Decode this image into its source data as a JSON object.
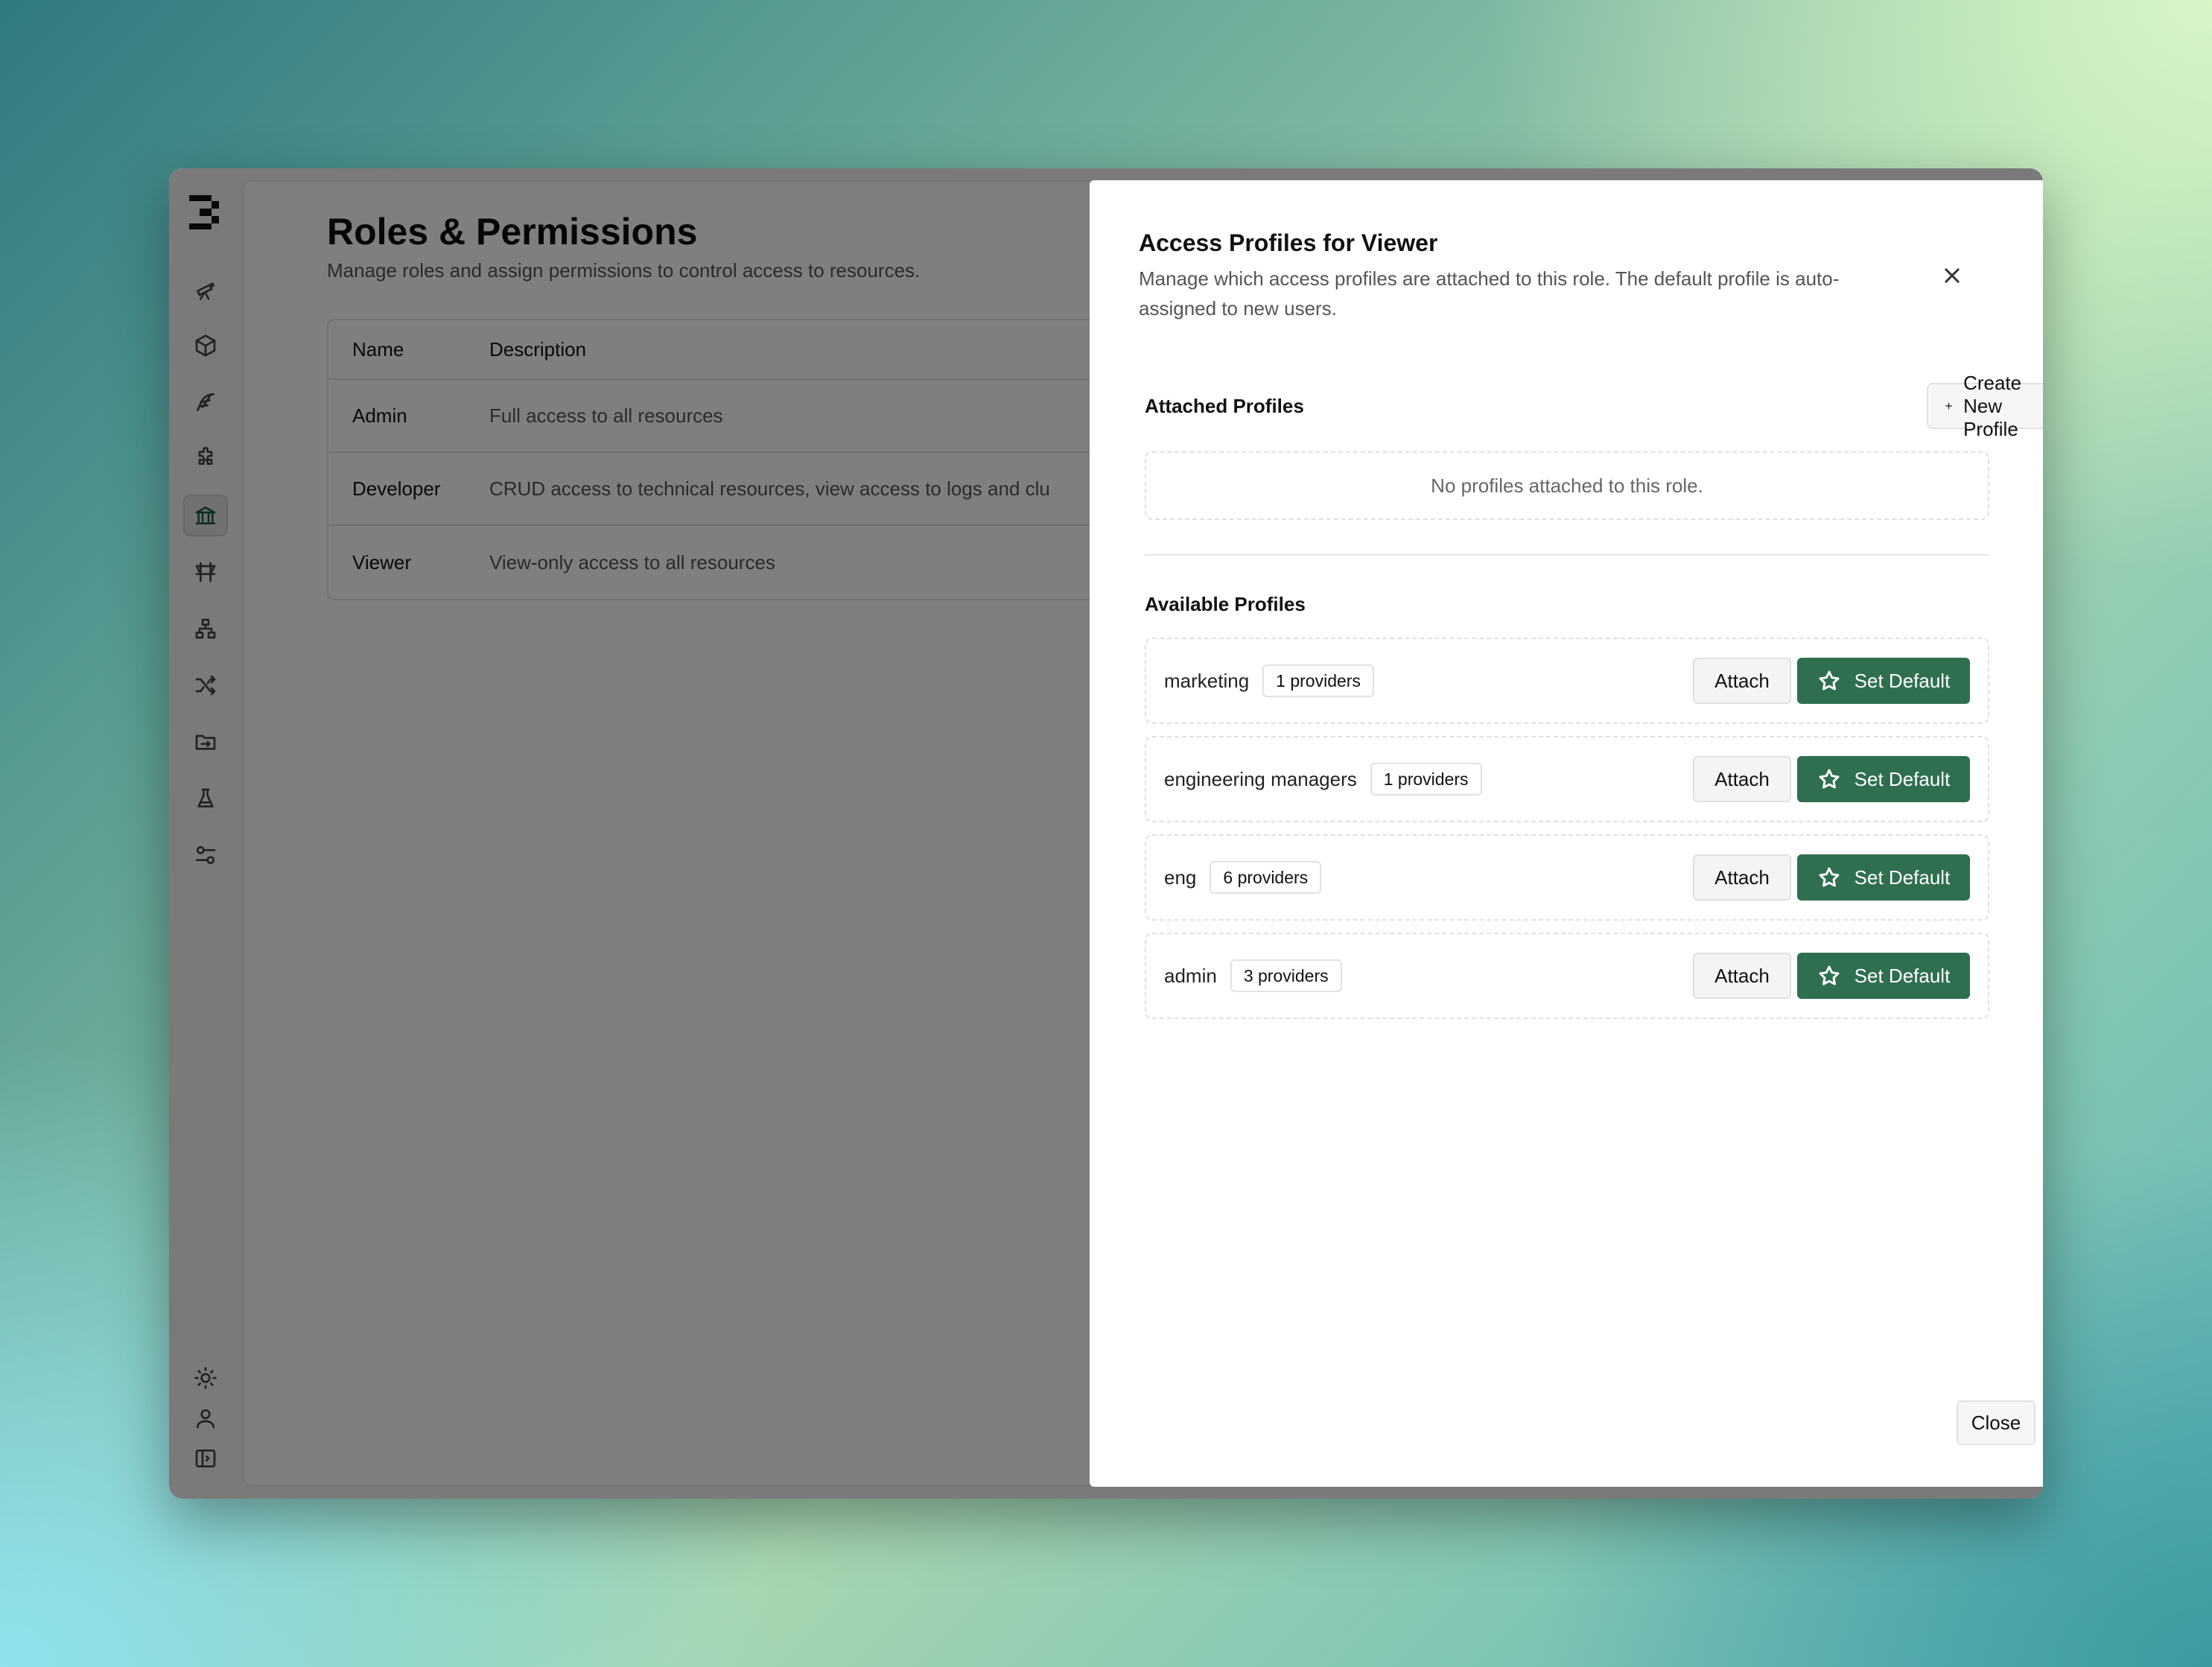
{
  "page": {
    "title": "Roles & Permissions",
    "subtitle": "Manage roles and assign permissions to control access to resources."
  },
  "table": {
    "headers": {
      "name": "Name",
      "description": "Description"
    },
    "rows": [
      {
        "name": "Admin",
        "description": "Full access to all resources"
      },
      {
        "name": "Developer",
        "description": "CRUD access to technical resources, view access to logs and clu"
      },
      {
        "name": "Viewer",
        "description": "View-only access to all resources"
      }
    ]
  },
  "sidebar": {
    "items": [
      {
        "icon": "telescope-icon"
      },
      {
        "icon": "box-icon"
      },
      {
        "icon": "feather-icon"
      },
      {
        "icon": "puzzle-icon"
      },
      {
        "icon": "bank-icon",
        "active": true
      },
      {
        "icon": "signpost-icon"
      },
      {
        "icon": "network-icon"
      },
      {
        "icon": "shuffle-icon"
      },
      {
        "icon": "folder-icon"
      },
      {
        "icon": "flask-icon"
      },
      {
        "icon": "settings-sliders-icon"
      }
    ],
    "bottom": [
      {
        "icon": "sun-icon"
      },
      {
        "icon": "user-icon"
      },
      {
        "icon": "sidebar-toggle-icon"
      }
    ]
  },
  "dialog": {
    "title": "Access Profiles for Viewer",
    "description": "Manage which access profiles are attached to this role. The default profile is auto-assigned to new users.",
    "attached_label": "Attached Profiles",
    "create_button": "Create New Profile",
    "empty_text": "No profiles attached to this role.",
    "available_label": "Available Profiles",
    "attach_label": "Attach",
    "set_default_label": "Set Default",
    "close_label": "Close",
    "profiles": [
      {
        "name": "marketing",
        "providers": "1 providers"
      },
      {
        "name": "engineering managers",
        "providers": "1 providers"
      },
      {
        "name": "eng",
        "providers": "6 providers"
      },
      {
        "name": "admin",
        "providers": "3 providers"
      }
    ]
  },
  "colors": {
    "accent": "#2f6f50",
    "overlay": "rgba(0,0,0,0.5)"
  }
}
